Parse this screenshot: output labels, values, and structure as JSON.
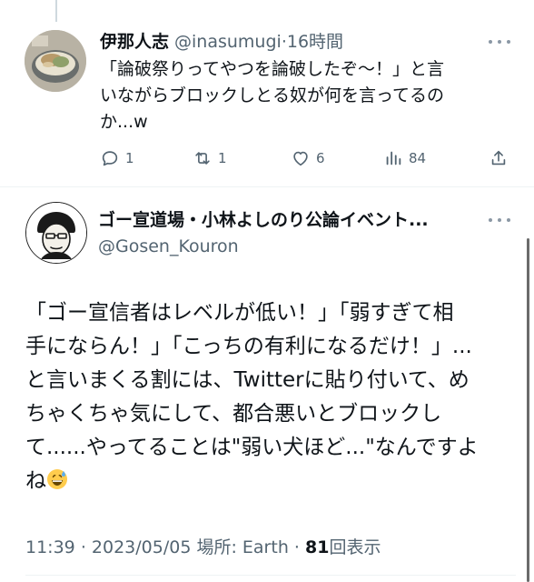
{
  "reply": {
    "author_name": "伊那人志",
    "handle": "@inasumugi",
    "separator": "·",
    "time": "16時間",
    "text_lines": [
      "「論破祭りってやつを論破したぞ〜！」と言",
      "いながらブロックしとる奴が何を言ってるの",
      "か...w"
    ],
    "actions": {
      "reply_count": "1",
      "retweet_count": "1",
      "like_count": "6",
      "views_count": "84"
    },
    "icons": [
      "comment-icon",
      "retweet-icon",
      "heart-icon",
      "analytics-icon",
      "share-icon",
      "more-icon"
    ]
  },
  "main": {
    "author_name": "ゴー宣道場・小林よしのり公論イベント...",
    "handle": "@Gosen_Kouron",
    "text_lines": [
      "「ゴー宣信者はレベルが低い！」「弱すぎて相",
      "手にならん！」「こっちの有利になるだけ！」...",
      "と言いまくる割には、Twitterに貼り付いて、め",
      "ちゃくちゃ気にして、都合悪いとブロックし",
      "て......やってることは\"弱い犬ほど...\"なんですよ",
      "ね"
    ],
    "emoji": "grinning-face-with-sweat",
    "meta": {
      "time": "11:39",
      "date": "2023/05/05",
      "location_label": "場所: Earth",
      "views_count": "81",
      "views_label": "回表示",
      "sep": "·"
    }
  },
  "colors": {
    "text": "#0f1419",
    "secondary": "#536471",
    "divider": "#eff3f4"
  }
}
